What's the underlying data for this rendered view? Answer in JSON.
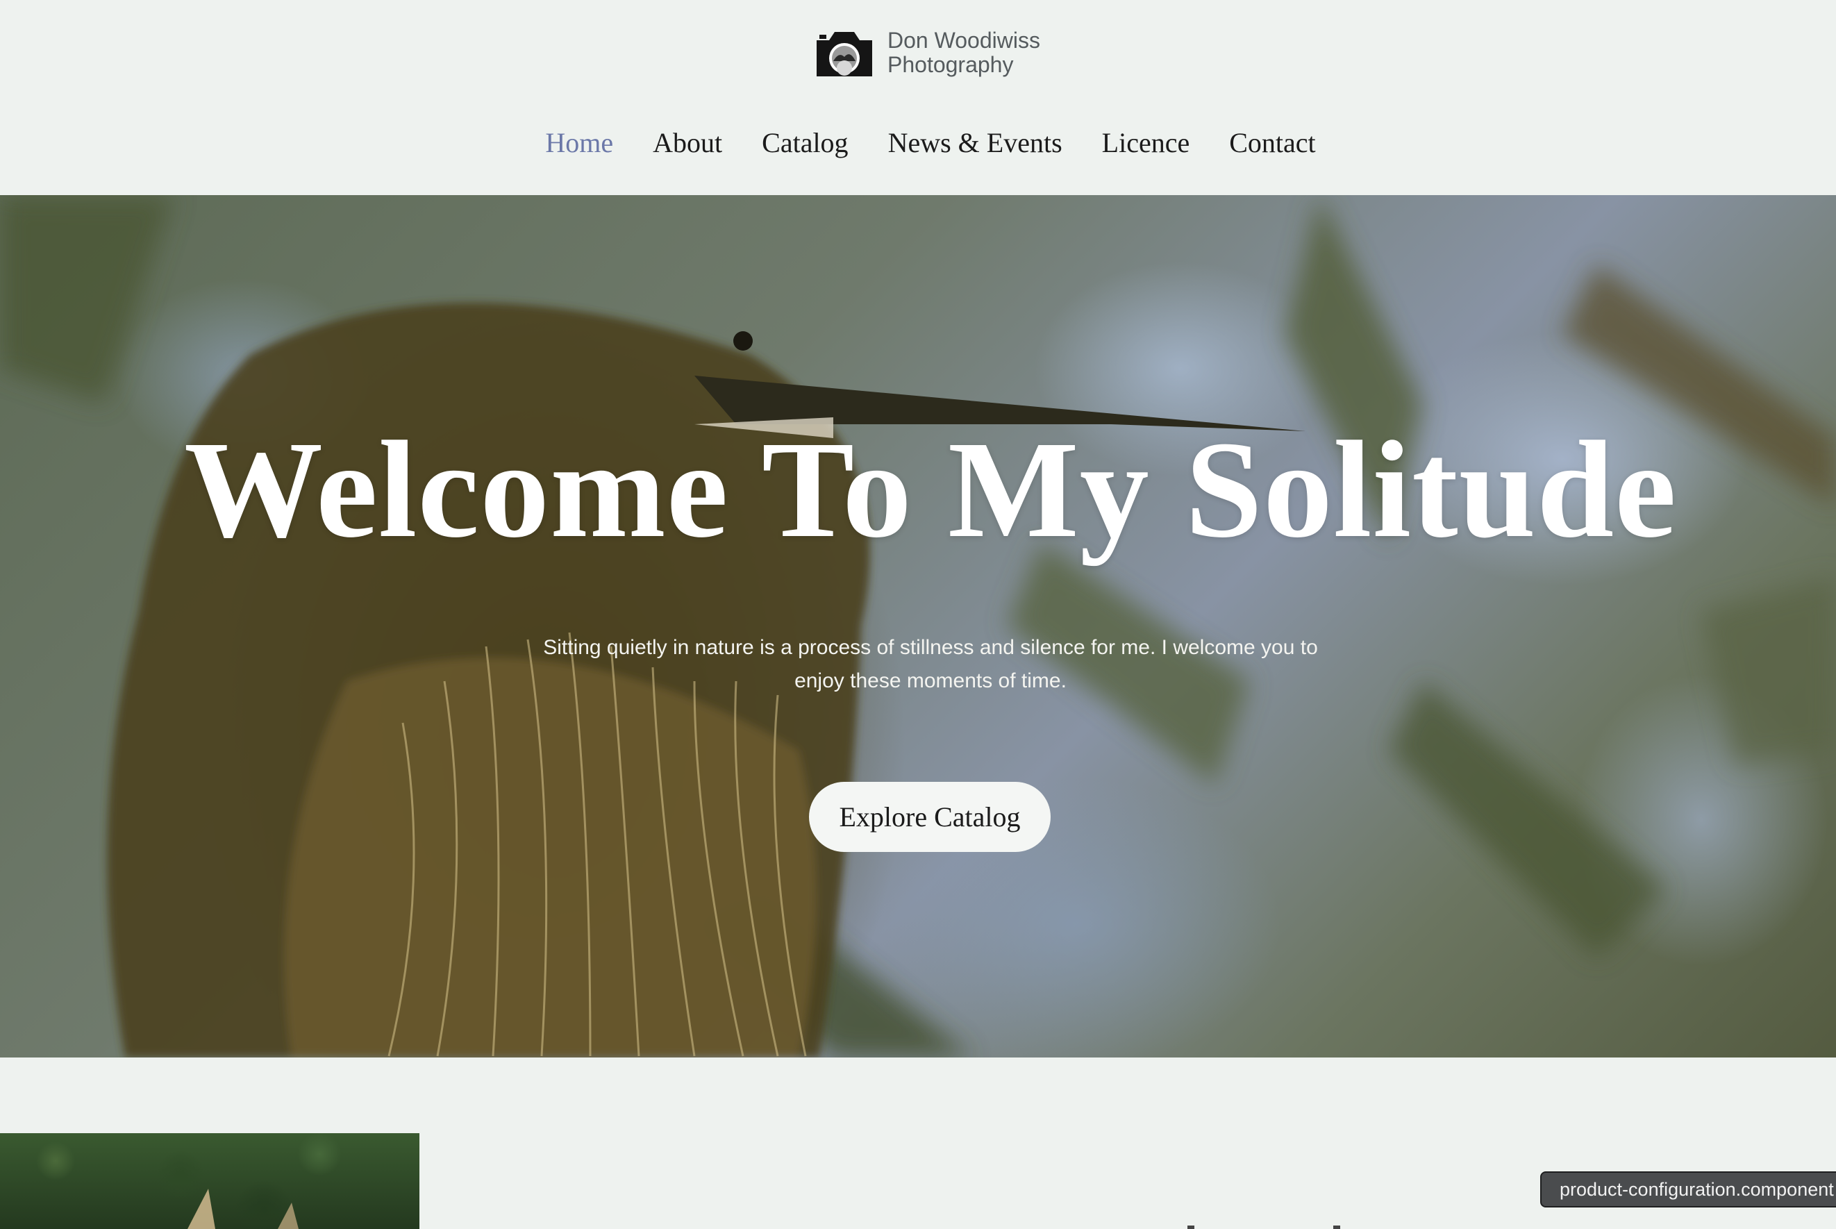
{
  "brand": {
    "line1": "Don Woodiwiss",
    "line2": "Photography",
    "logo_icon": "camera-icon"
  },
  "nav": {
    "items": [
      {
        "label": "Home",
        "active": true
      },
      {
        "label": "About",
        "active": false
      },
      {
        "label": "Catalog",
        "active": false
      },
      {
        "label": "News & Events",
        "active": false
      },
      {
        "label": "Licence",
        "active": false
      },
      {
        "label": "Contact",
        "active": false
      }
    ],
    "active_color": "#6b78a8"
  },
  "hero": {
    "title": "Welcome To My Solitude",
    "subtitle": "Sitting quietly in nature is a process of stillness and silence for me. I welcome you to enjoy these moments of time.",
    "button_label": "Explore Catalog"
  },
  "tooltip": {
    "text": "product-configuration.component"
  },
  "colors": {
    "page_background": "#eef2ef",
    "button_background": "#f4f6f4",
    "tooltip_background": "#4a4c4e"
  }
}
